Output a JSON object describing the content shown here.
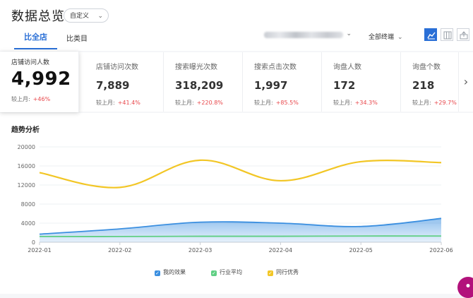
{
  "header": {
    "title": "数据总览",
    "range_select": "自定义",
    "tabs": [
      {
        "label": "比全店"
      },
      {
        "label": "比类目"
      }
    ],
    "terminal_select": "全部终端",
    "view_icons": [
      "line-chart-icon",
      "table-icon",
      "export-icon"
    ]
  },
  "metrics": [
    {
      "label": "店铺访问人数",
      "value": "4,992",
      "compare_label": "较上月:",
      "change": "+46%"
    },
    {
      "label": "店铺访问次数",
      "value": "7,889",
      "compare_label": "较上月:",
      "change": "+41.4%"
    },
    {
      "label": "搜索曝光次数",
      "value": "318,209",
      "compare_label": "较上月:",
      "change": "+220.8%"
    },
    {
      "label": "搜索点击次数",
      "value": "1,997",
      "compare_label": "较上月:",
      "change": "+85.5%"
    },
    {
      "label": "询盘人数",
      "value": "172",
      "compare_label": "较上月:",
      "change": "+34.3%"
    },
    {
      "label": "询盘个数",
      "value": "218",
      "compare_label": "较上月:",
      "change": "+29.7%"
    }
  ],
  "chart_section": {
    "title": "趋势分析"
  },
  "colors": {
    "accent": "#2a6fd6",
    "up": "#e8474b",
    "mine": "#3b8fe0",
    "industry": "#5fcf83",
    "peer": "#f2c625"
  },
  "chart_data": {
    "type": "line",
    "x": [
      "2022-01",
      "2022-02",
      "2022-03",
      "2022-04",
      "2022-05",
      "2022-06"
    ],
    "ylim": [
      0,
      20000
    ],
    "yticks": [
      0,
      4000,
      8000,
      12000,
      16000,
      20000
    ],
    "grid": true,
    "legend_position": "bottom",
    "series": [
      {
        "name": "我的效果",
        "values": [
          1700,
          2800,
          4200,
          4000,
          3300,
          4992
        ],
        "color": "#3b8fe0",
        "fill": true
      },
      {
        "name": "行业平均",
        "values": [
          1200,
          1200,
          1250,
          1250,
          1300,
          1300
        ],
        "color": "#5fcf83",
        "fill": false
      },
      {
        "name": "同行优秀",
        "values": [
          14600,
          11500,
          17200,
          12900,
          16900,
          16700
        ],
        "color": "#f2c625",
        "fill": false
      }
    ]
  }
}
